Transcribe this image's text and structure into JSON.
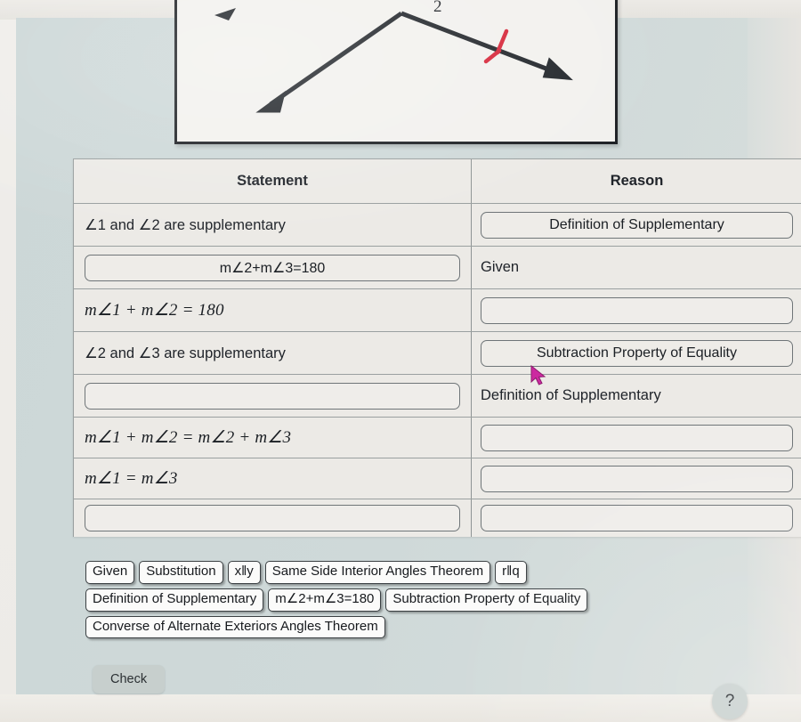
{
  "figure": {
    "description": "Two rays forming an inverted V with arrowheads and a red angle tick mark",
    "angle_label_top": "2",
    "red_mark_color": "#d6273a",
    "line_color": "#22262b"
  },
  "table": {
    "headers": {
      "statement": "Statement",
      "reason": "Reason"
    },
    "rows": [
      {
        "statement": {
          "kind": "text",
          "text": "∠1 and ∠2 are supplementary"
        },
        "reason": {
          "kind": "dropzone",
          "text": "Definition of Supplementary"
        }
      },
      {
        "statement": {
          "kind": "dropzone",
          "text": "m∠2+m∠3=180"
        },
        "reason": {
          "kind": "text",
          "text": "Given"
        }
      },
      {
        "statement": {
          "kind": "math",
          "text": "m∠1 + m∠2 = 180"
        },
        "reason": {
          "kind": "dropzone",
          "text": ""
        }
      },
      {
        "statement": {
          "kind": "text",
          "text": "∠2 and ∠3 are supplementary"
        },
        "reason": {
          "kind": "dropzone",
          "text": "Subtraction Property of Equality"
        }
      },
      {
        "statement": {
          "kind": "dropzone",
          "text": ""
        },
        "reason": {
          "kind": "text",
          "text": "Definition of Supplementary"
        }
      },
      {
        "statement": {
          "kind": "math",
          "text": "m∠1 + m∠2 = m∠2 + m∠3"
        },
        "reason": {
          "kind": "dropzone",
          "text": ""
        }
      },
      {
        "statement": {
          "kind": "math",
          "text": "m∠1 = m∠3"
        },
        "reason": {
          "kind": "dropzone",
          "text": ""
        }
      },
      {
        "statement": {
          "kind": "dropzone",
          "text": ""
        },
        "reason": {
          "kind": "dropzone",
          "text": ""
        }
      }
    ]
  },
  "answer_bank": {
    "rows": [
      [
        "Given",
        "Substitution",
        "x‖y",
        "Same Side Interior Angles Theorem",
        "r‖q"
      ],
      [
        "Definition of Supplementary",
        "m∠2+m∠3=180",
        "Subtraction Property of Equality"
      ],
      [
        "Converse of Alternate Exteriors Angles Theorem"
      ]
    ]
  },
  "footer": {
    "check_label": "Check",
    "help_label": "?"
  },
  "colors": {
    "panel": "#ccd7d7",
    "table_bg": "#eceae6",
    "pill_bg": "#fbfbfa",
    "cursor": "#cc29a0",
    "red_mark": "#d6273a"
  }
}
